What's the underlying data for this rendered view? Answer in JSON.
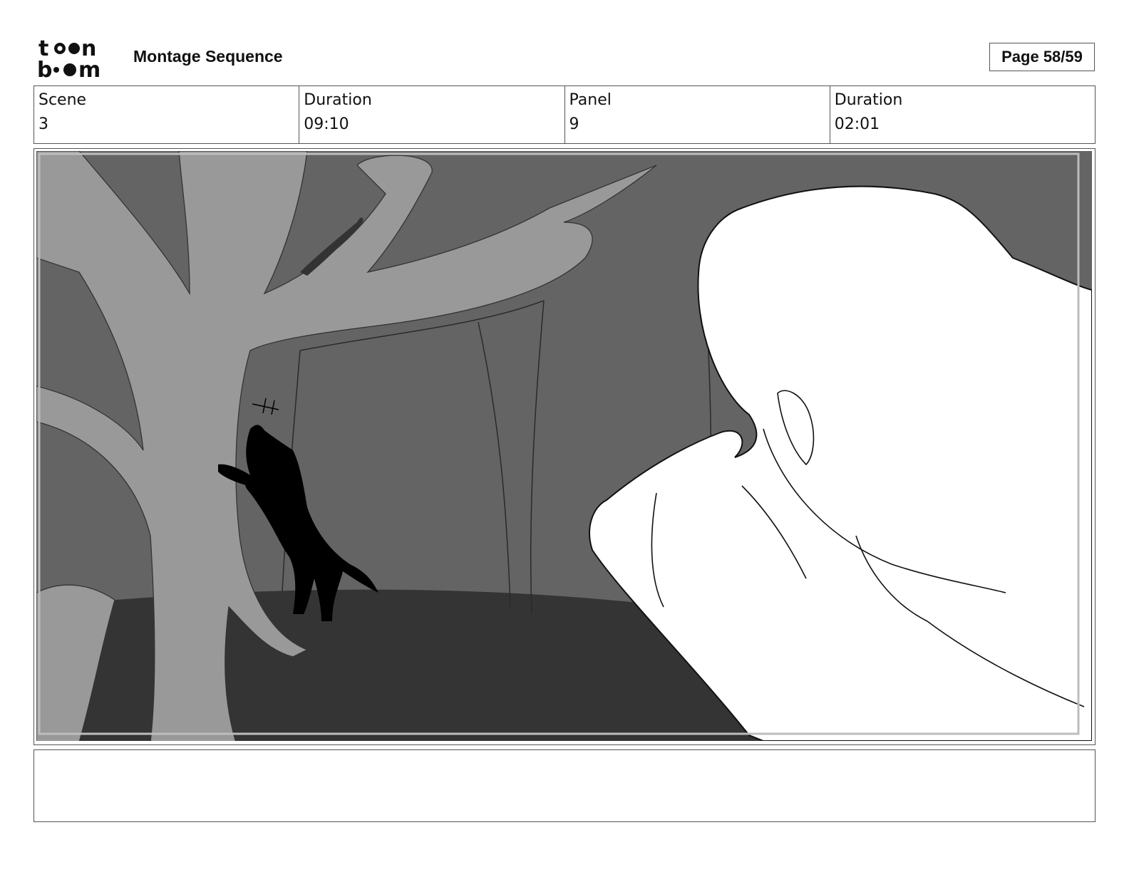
{
  "header": {
    "logo_text": "toon boom",
    "title": "Montage Sequence",
    "page_label": "Page 58/59"
  },
  "info": {
    "scene_label": "Scene",
    "scene_value": "3",
    "scene_duration_label": "Duration",
    "scene_duration_value": "09:10",
    "panel_label": "Panel",
    "panel_value": "9",
    "panel_duration_label": "Duration",
    "panel_duration_value": "02:01"
  },
  "notes": {
    "text": ""
  },
  "colors": {
    "sky": "#646464",
    "ground": "#343434",
    "tree": "#999999",
    "silhouette": "#000000",
    "foreground_figure": "#ffffff"
  }
}
